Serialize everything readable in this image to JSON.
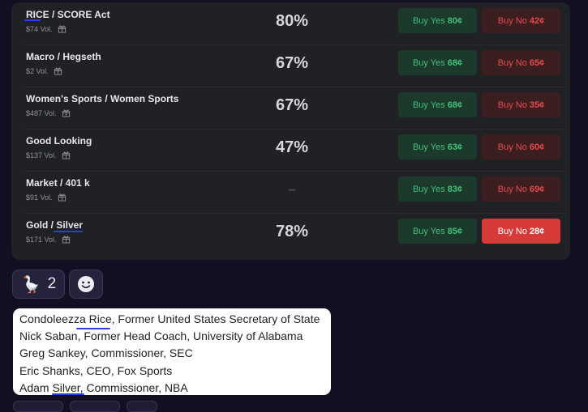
{
  "markets": [
    {
      "name": "RICE / SCORE Act",
      "volume": "$74 Vol.",
      "percent": "80%",
      "yes_label": "Buy Yes",
      "yes_price": "80¢",
      "no_label": "Buy No",
      "no_price": "42¢"
    },
    {
      "name": "Macro / Hegseth",
      "volume": "$2 Vol.",
      "percent": "67%",
      "yes_label": "Buy Yes",
      "yes_price": "68¢",
      "no_label": "Buy No",
      "no_price": "65¢"
    },
    {
      "name": "Women's Sports / Women Sports",
      "volume": "$487 Vol.",
      "percent": "67%",
      "yes_label": "Buy Yes",
      "yes_price": "68¢",
      "no_label": "Buy No",
      "no_price": "35¢"
    },
    {
      "name": "Good Looking",
      "volume": "$137 Vol.",
      "percent": "47%",
      "yes_label": "Buy Yes",
      "yes_price": "63¢",
      "no_label": "Buy No",
      "no_price": "60¢"
    },
    {
      "name": "Market / 401 k",
      "volume": "$91 Vol.",
      "percent": "–",
      "yes_label": "Buy Yes",
      "yes_price": "83¢",
      "no_label": "Buy No",
      "no_price": "69¢"
    },
    {
      "name": "Gold / Silver",
      "volume": "$171 Vol.",
      "percent": "78%",
      "yes_label": "Buy Yes",
      "yes_price": "85¢",
      "no_label": "Buy No",
      "no_price": "28¢"
    }
  ],
  "reactions": {
    "goose_emoji": "🪿",
    "goose_count": "2",
    "add_reaction_icon": "smiley-icon"
  },
  "notes": {
    "lines": [
      "Condoleezza Rice, Former United States Secretary of State",
      "Nick Saban, Former Head Coach, University of Alabama",
      "Greg Sankey, Commissioner, SEC",
      "Eric Shanks, CEO, Fox Sports",
      "Adam Silver, Commissioner, NBA"
    ]
  },
  "colors": {
    "background": "#110f22",
    "panel": "#1f2124",
    "yes_green": "#43c07a",
    "no_red": "#e44b4b",
    "active_no": "#d83a3a",
    "underline_blue": "#2b3fe0"
  }
}
